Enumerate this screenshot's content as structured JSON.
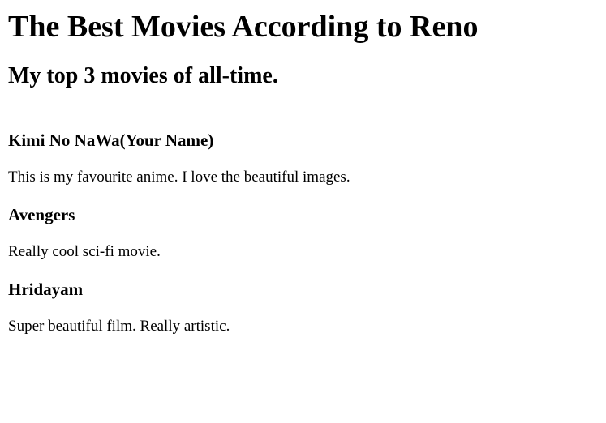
{
  "page": {
    "title": "The Best Movies According to Reno",
    "subtitle": "My top 3 movies of all-time."
  },
  "movies": [
    {
      "title": "Kimi No NaWa(Your Name)",
      "description": "This is my favourite anime. I love the beautiful images."
    },
    {
      "title": "Avengers",
      "description": "Really cool sci-fi movie."
    },
    {
      "title": "Hridayam",
      "description": "Super beautiful film. Really artistic."
    }
  ]
}
